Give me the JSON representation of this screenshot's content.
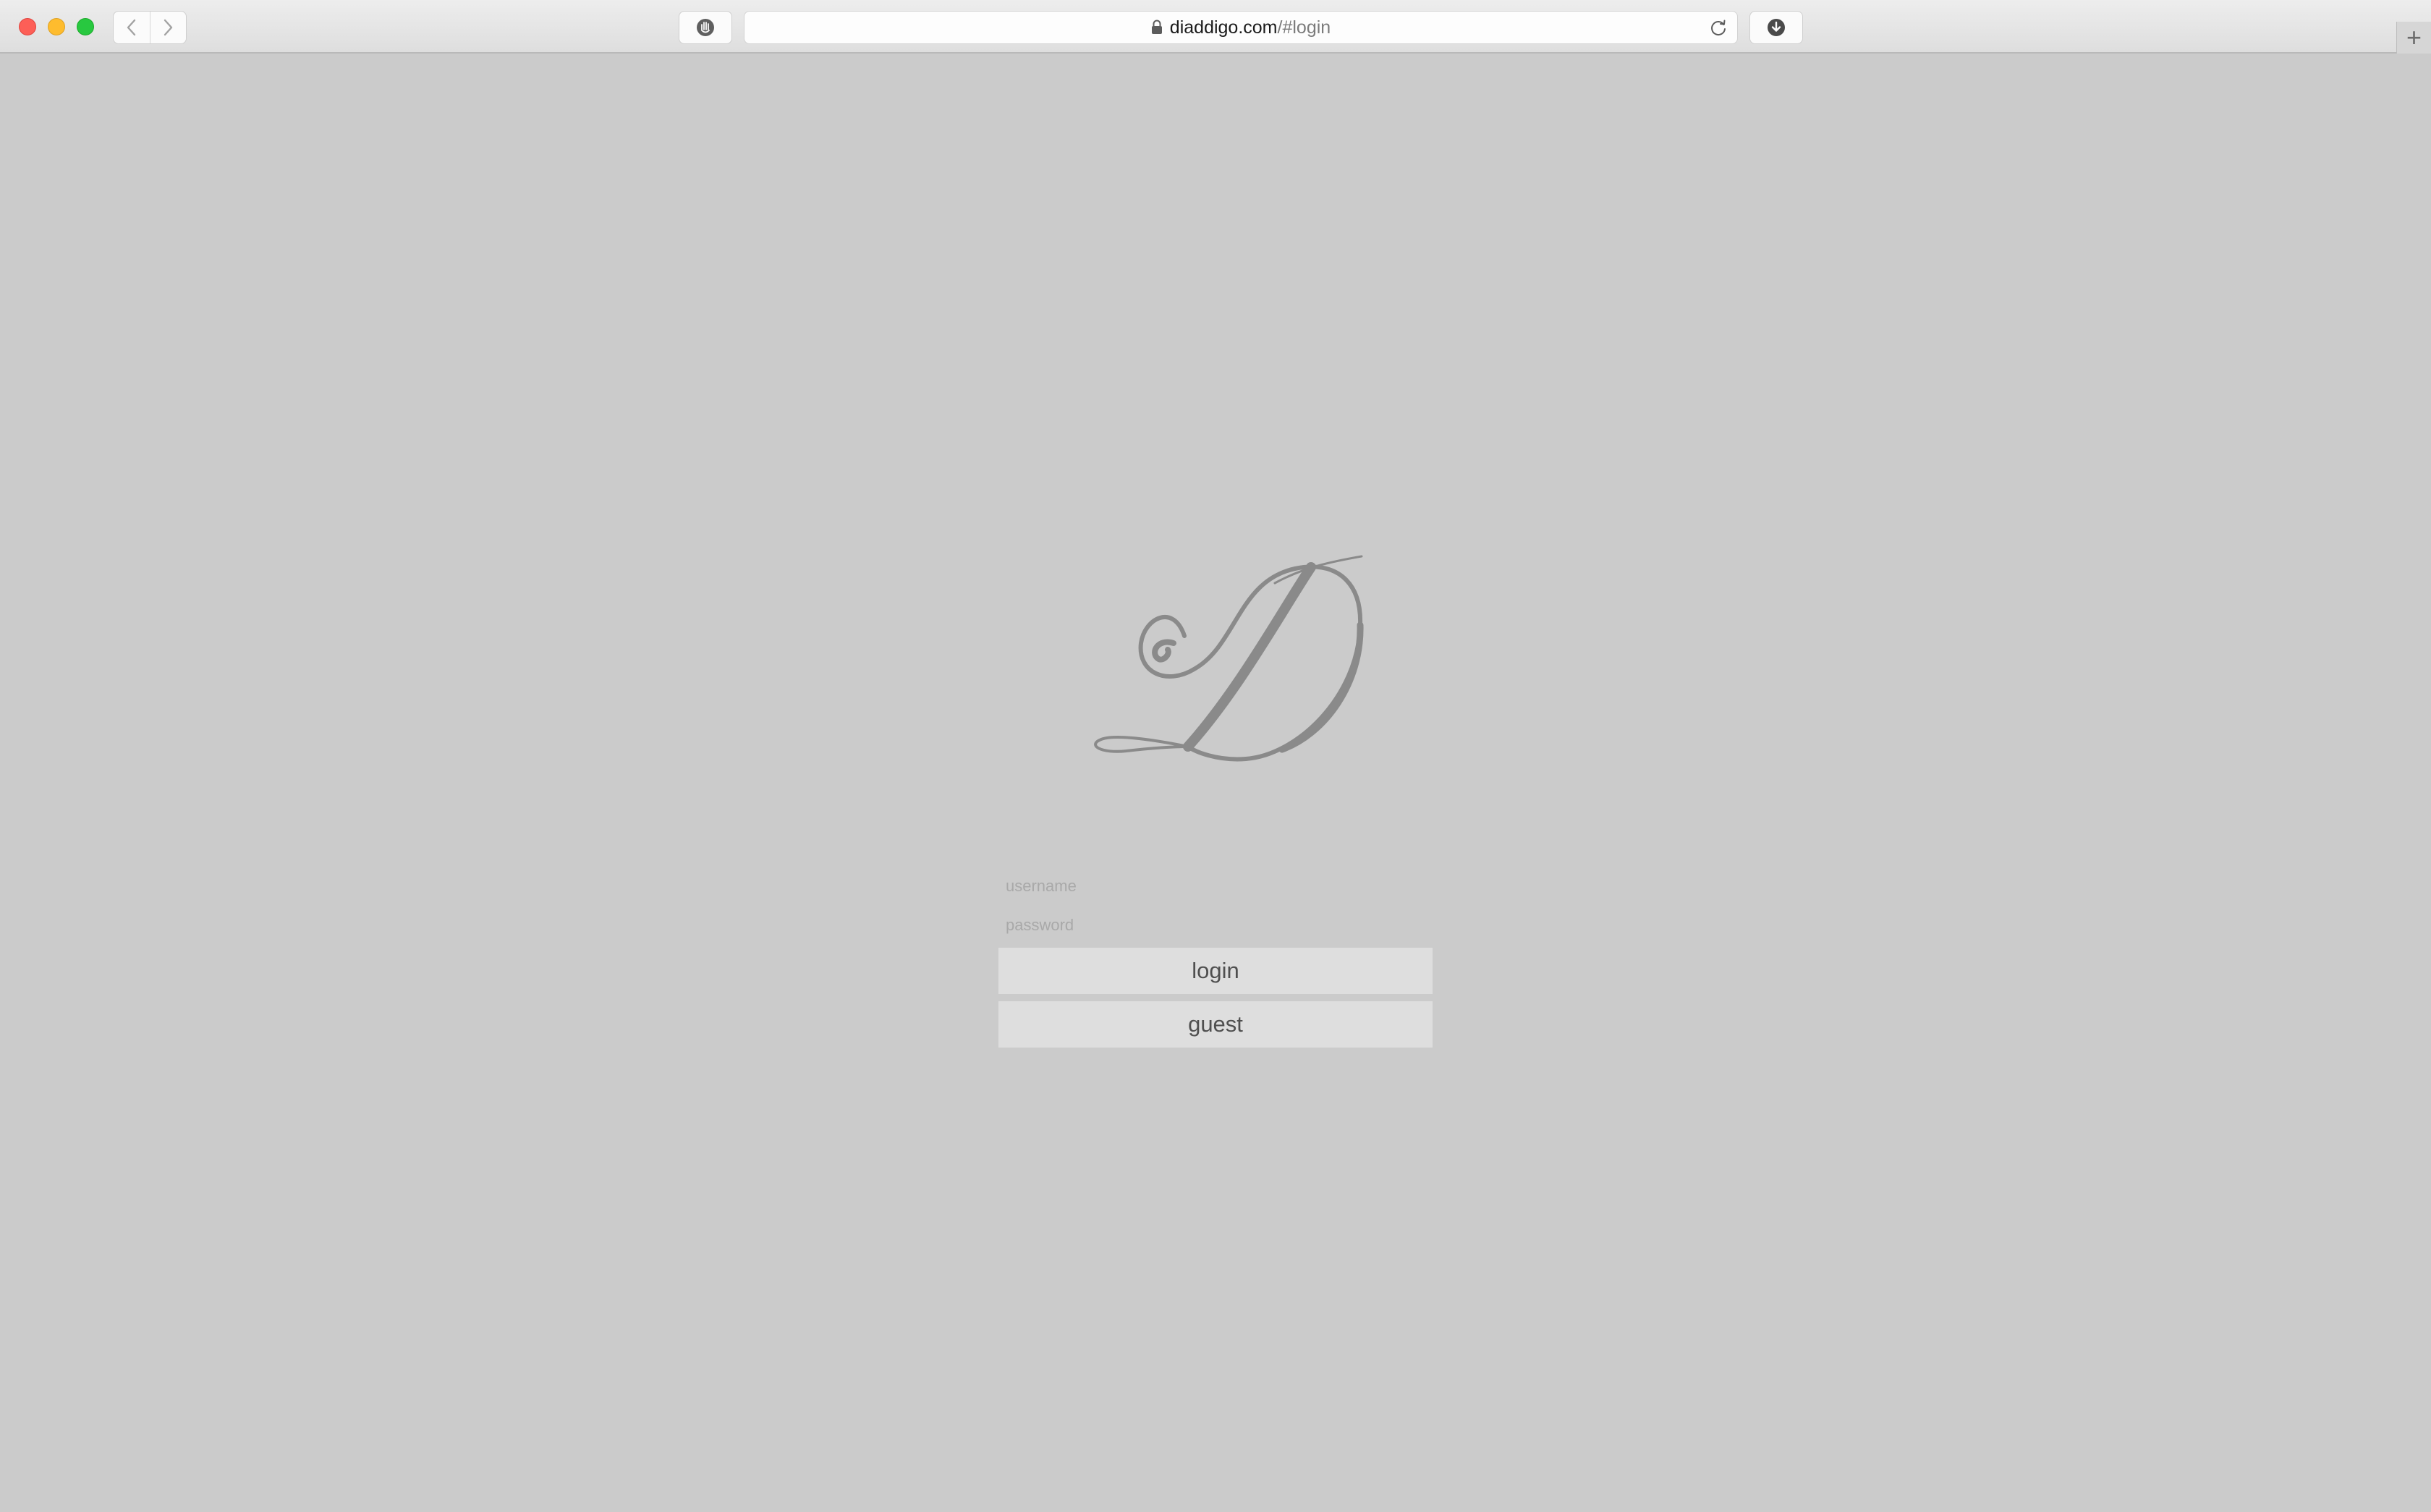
{
  "browser": {
    "url_domain": "diaddigo.com",
    "url_path": "/#login",
    "new_tab_symbol": "+",
    "icons": {
      "back": "chevron-left-icon",
      "forward": "chevron-right-icon",
      "privacy": "hand-shield-icon",
      "lock": "lock-icon",
      "reload": "reload-icon",
      "download": "download-icon"
    }
  },
  "login": {
    "logo_letter": "D",
    "username_placeholder": "username",
    "password_placeholder": "password",
    "login_label": "login",
    "guest_label": "guest"
  },
  "colors": {
    "page_background": "#cbcbcb",
    "button_background": "#dedede",
    "logo": "#8a8a8a",
    "close": "#fd5f57",
    "minimize": "#febc2e",
    "maximize": "#28c840"
  }
}
